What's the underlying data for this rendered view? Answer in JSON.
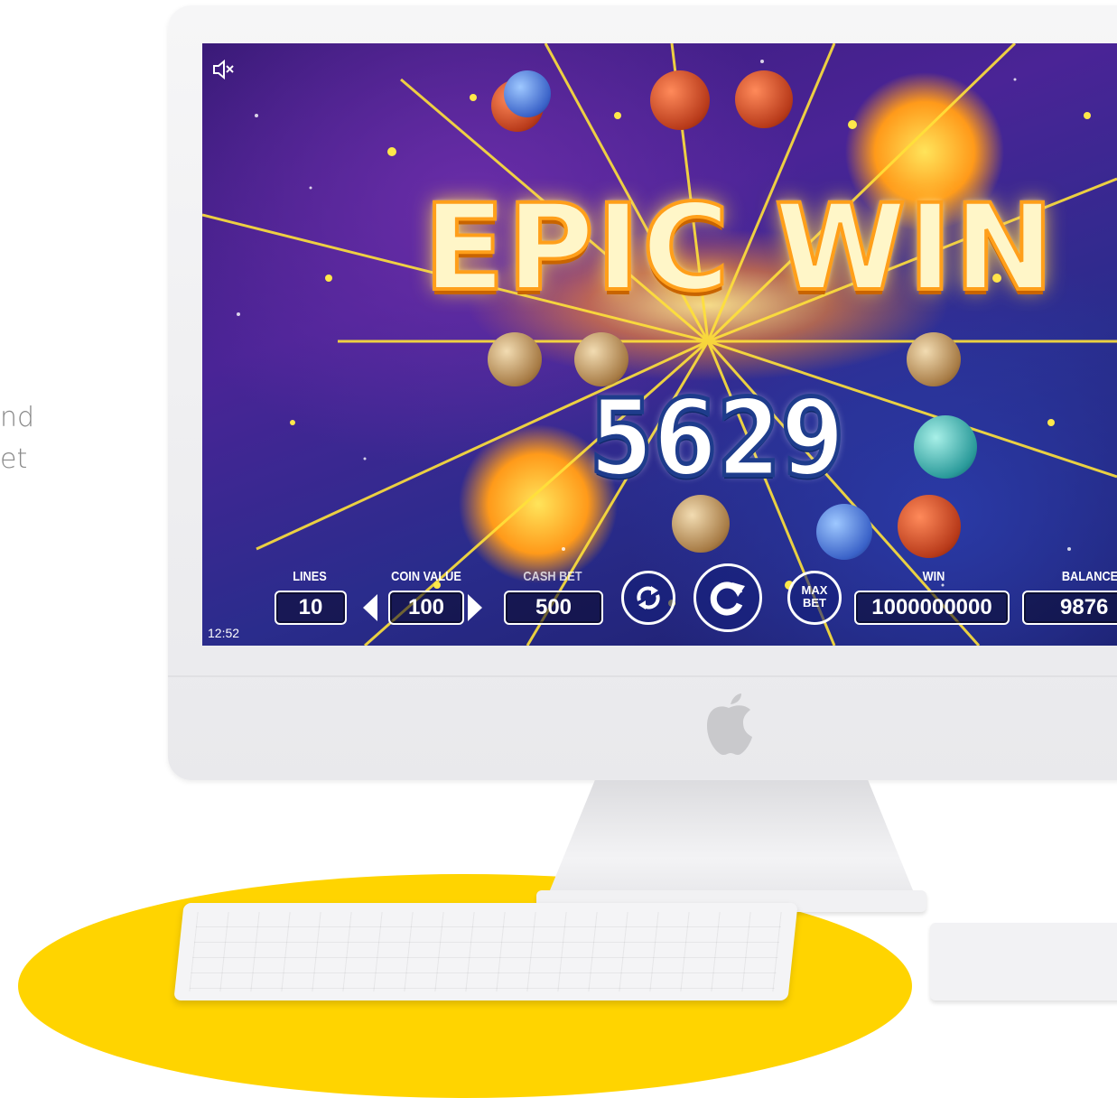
{
  "side_text": {
    "line1": "nd",
    "line2": "et"
  },
  "game": {
    "headline": "EPIC WIN",
    "win_amount": "5629",
    "clock": "12:52",
    "controls": {
      "lines_label": "LINES",
      "lines_value": "10",
      "coin_value_label": "COIN VALUE",
      "coin_value": "100",
      "cash_bet_label": "CASH BET",
      "cash_bet_value": "500",
      "max_bet_line1": "MAX",
      "max_bet_line2": "BET",
      "win_label": "WIN",
      "win_value": "1000000000",
      "balance_label": "BALANCE",
      "balance_value": "9876"
    },
    "icons": {
      "sound": "speaker-muted-icon",
      "autoplay": "autoplay-icon",
      "spin": "spin-icon",
      "coin_left": "arrow-left-icon",
      "coin_right": "arrow-right-icon"
    }
  },
  "colors": {
    "accent_yellow": "#ffd400",
    "text_outline": "#1e3c8c",
    "headline_glow": "#ff9f1a"
  }
}
